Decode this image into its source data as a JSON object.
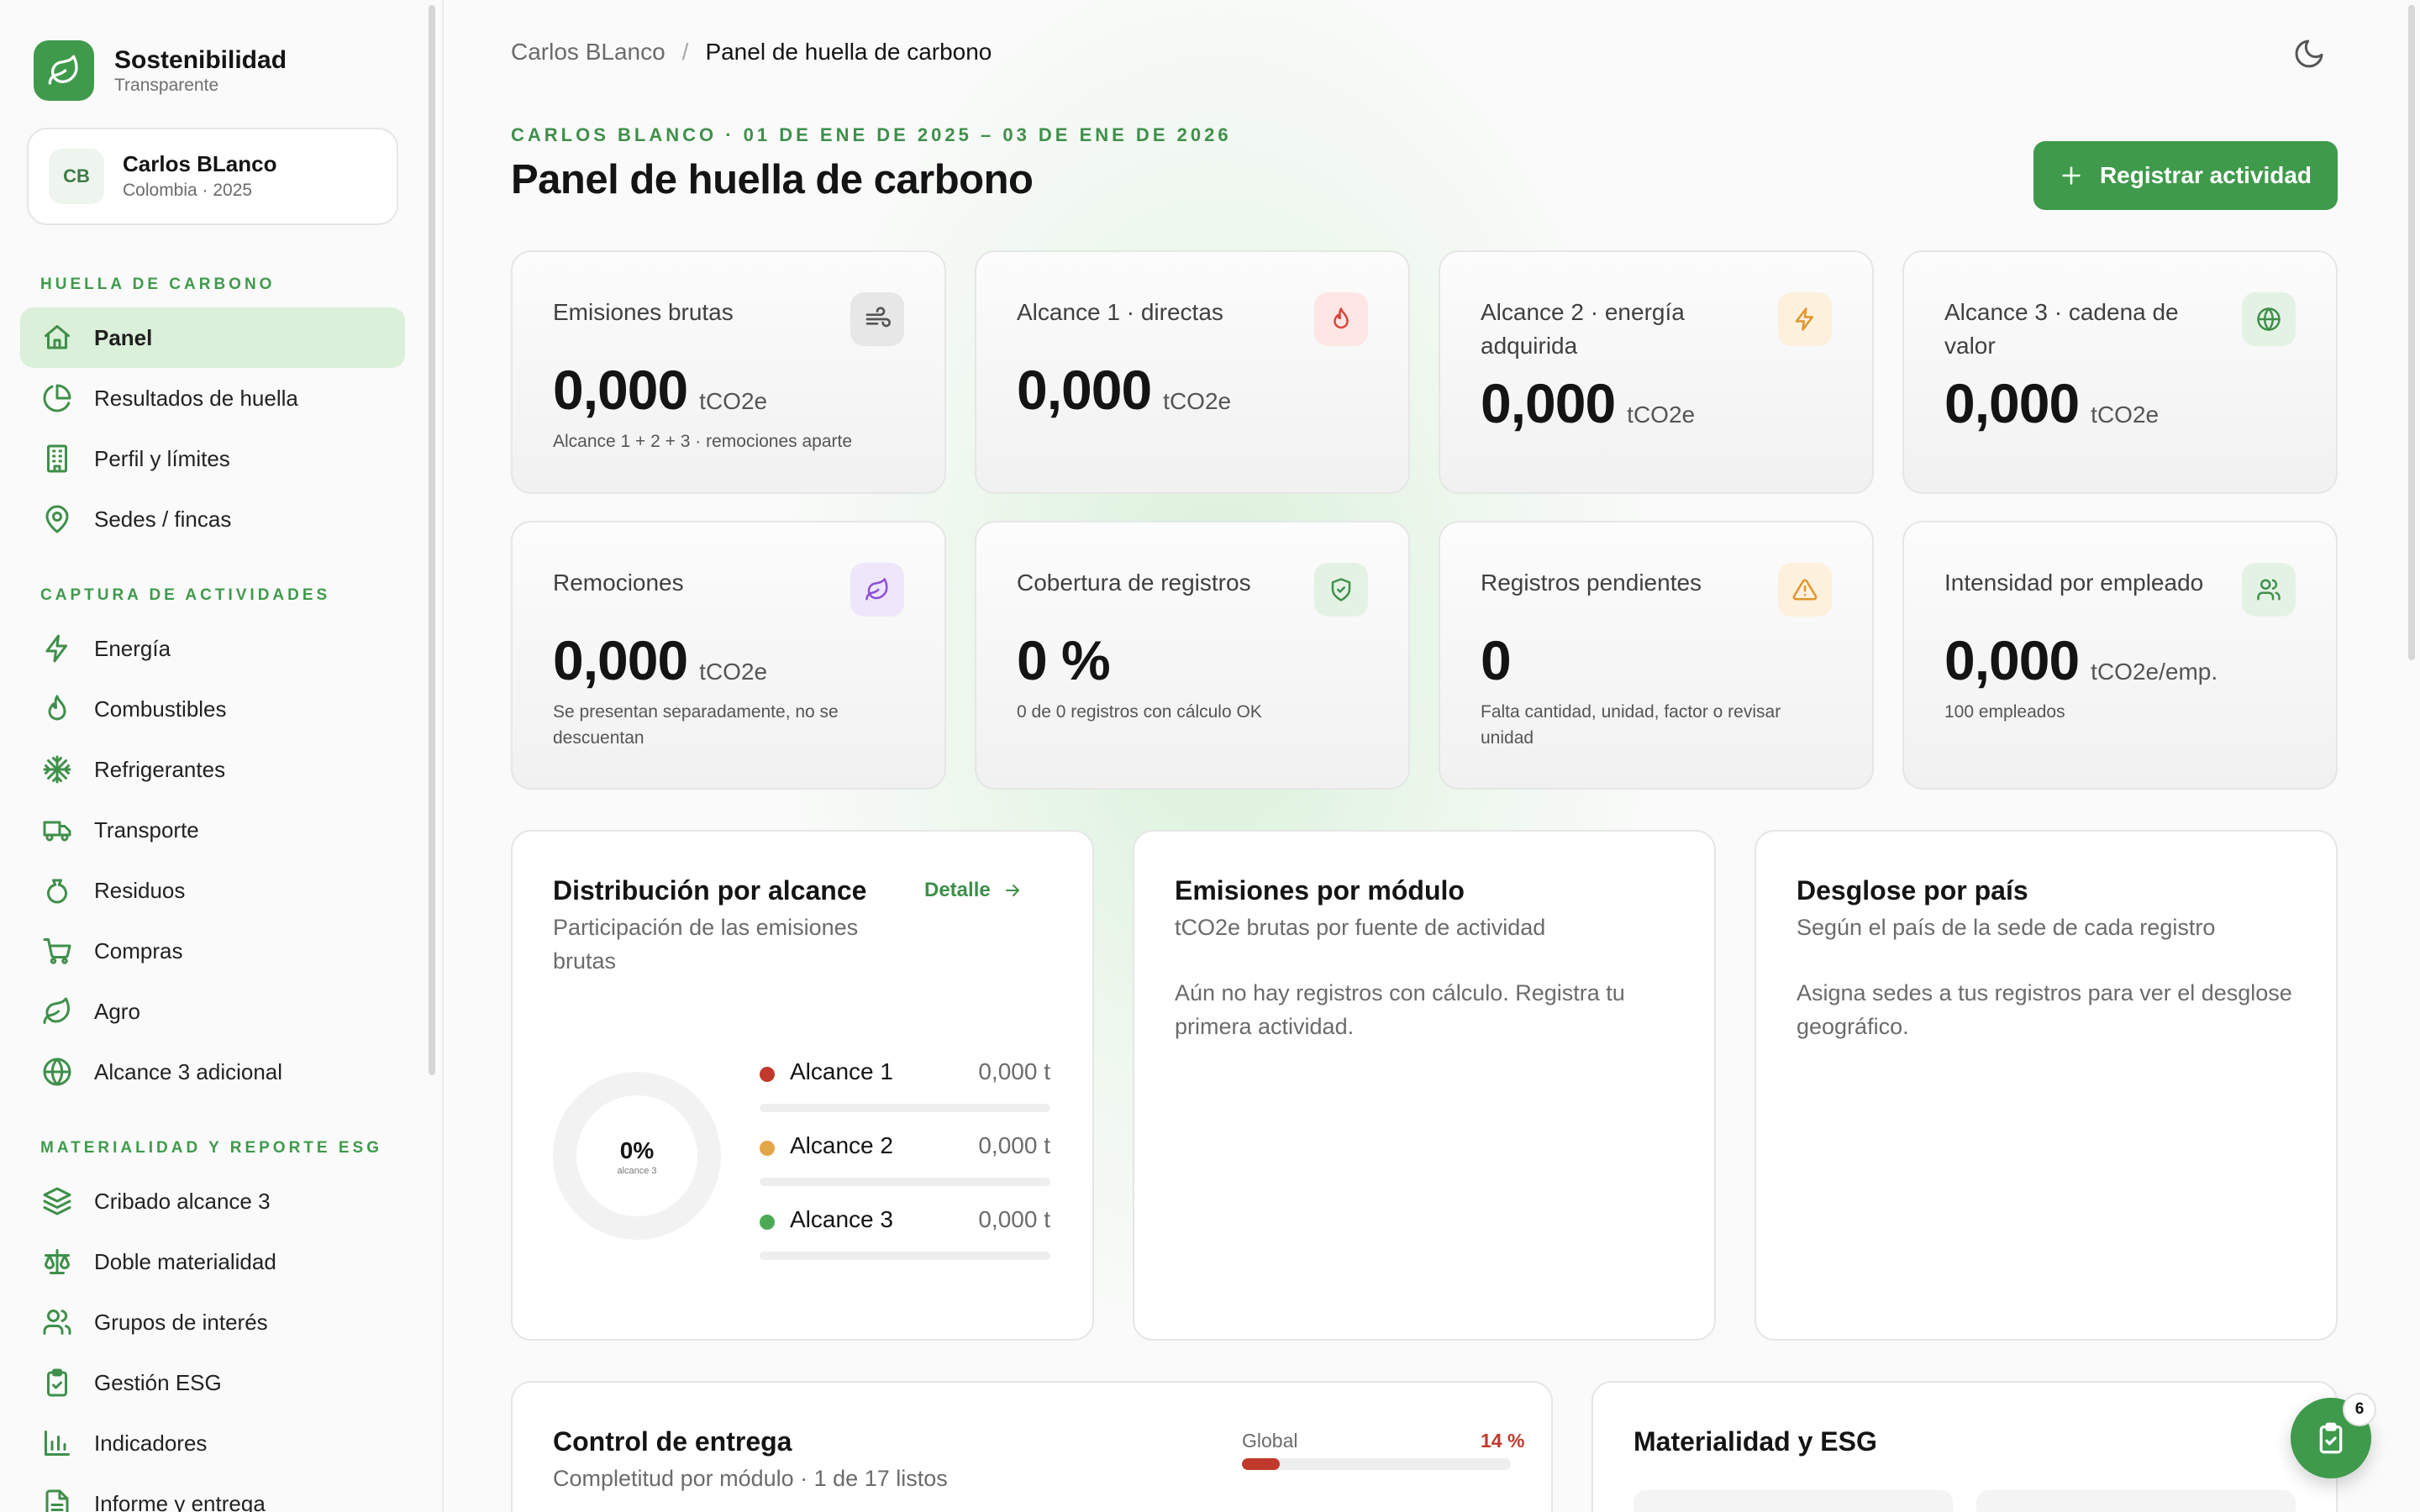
{
  "brand": {
    "name": "Sostenibilidad",
    "subtitle": "Transparente"
  },
  "user": {
    "initials": "CB",
    "name": "Carlos BLanco",
    "meta": "Colombia · 2025"
  },
  "sidebar": {
    "sections": [
      {
        "title": "HUELLA DE CARBONO",
        "items": [
          {
            "label": "Panel",
            "icon": "home-icon",
            "active": true
          },
          {
            "label": "Resultados de huella",
            "icon": "pie-chart-icon"
          },
          {
            "label": "Perfil y límites",
            "icon": "building-icon"
          },
          {
            "label": "Sedes / fincas",
            "icon": "map-pin-icon"
          }
        ]
      },
      {
        "title": "CAPTURA DE ACTIVIDADES",
        "items": [
          {
            "label": "Energía",
            "icon": "lightning-icon"
          },
          {
            "label": "Combustibles",
            "icon": "flame-icon"
          },
          {
            "label": "Refrigerantes",
            "icon": "snowflake-icon"
          },
          {
            "label": "Transporte",
            "icon": "truck-icon"
          },
          {
            "label": "Residuos",
            "icon": "waste-bag-icon"
          },
          {
            "label": "Compras",
            "icon": "shopping-cart-icon"
          },
          {
            "label": "Agro",
            "icon": "leaf-icon"
          },
          {
            "label": "Alcance 3 adicional",
            "icon": "globe-icon"
          }
        ]
      },
      {
        "title": "MATERIALIDAD Y REPORTE ESG",
        "items": [
          {
            "label": "Cribado alcance 3",
            "icon": "layers-icon"
          },
          {
            "label": "Doble materialidad",
            "icon": "scale-icon"
          },
          {
            "label": "Grupos de interés",
            "icon": "users-icon"
          },
          {
            "label": "Gestión ESG",
            "icon": "clipboard-check-icon"
          },
          {
            "label": "Indicadores",
            "icon": "bar-chart-icon"
          },
          {
            "label": "Informe y entrega",
            "icon": "document-icon"
          }
        ]
      }
    ]
  },
  "breadcrumb": {
    "parent": "Carlos BLanco",
    "separator": "/",
    "current": "Panel de huella de carbono"
  },
  "header": {
    "eyebrow": "CARLOS BLANCO · 01 DE ENE DE 2025 – 03 DE ENE DE 2026",
    "title": "Panel de huella de carbono",
    "primary_action": "Registrar actividad"
  },
  "kpis": [
    {
      "label": "Emisiones brutas",
      "value": "0,000",
      "unit": "tCO2e",
      "note": "Alcance 1 + 2 + 3 · remociones aparte",
      "icon": "wind-icon",
      "icon_color": "#555555",
      "icon_bg": "#e7e7e7"
    },
    {
      "label": "Alcance 1 · directas",
      "value": "0,000",
      "unit": "tCO2e",
      "note": "",
      "icon": "flame-icon",
      "icon_color": "#d9443a",
      "icon_bg": "#fde6e4"
    },
    {
      "label": "Alcance 2 · energía adquirida",
      "value": "0,000",
      "unit": "tCO2e",
      "note": "",
      "icon": "lightning-icon",
      "icon_color": "#e0952b",
      "icon_bg": "#fdf0dc"
    },
    {
      "label": "Alcance 3 · cadena de valor",
      "value": "0,000",
      "unit": "tCO2e",
      "note": "",
      "icon": "globe-icon",
      "icon_color": "#3f8f4a",
      "icon_bg": "#e4f2e4"
    },
    {
      "label": "Remociones",
      "value": "0,000",
      "unit": "tCO2e",
      "note": "Se presentan separadamente, no se descuentan",
      "icon": "leaf-icon",
      "icon_color": "#8b4fd6",
      "icon_bg": "#efe6fb"
    },
    {
      "label": "Cobertura de registros",
      "value": "0 %",
      "unit": "",
      "note": "0 de 0 registros con cálculo OK",
      "icon": "shield-check-icon",
      "icon_color": "#3f8f4a",
      "icon_bg": "#e4f2e4"
    },
    {
      "label": "Registros pendientes",
      "value": "0",
      "unit": "",
      "note": "Falta cantidad, unidad, factor o revisar unidad",
      "icon": "warning-icon",
      "icon_color": "#e0952b",
      "icon_bg": "#fdf0dc"
    },
    {
      "label": "Intensidad por empleado",
      "value": "0,000",
      "unit": "tCO2e/emp.",
      "note": "100 empleados",
      "icon": "users-icon",
      "icon_color": "#3f8f4a",
      "icon_bg": "#e4f2e4"
    }
  ],
  "distribution": {
    "title": "Distribución por alcance",
    "subtitle": "Participación de las emisiones brutas",
    "detail_link": "Detalle",
    "donut_value": "0%",
    "donut_label": "alcance 3",
    "donut_fraction": 0,
    "scopes": [
      {
        "name": "Alcance 1",
        "value": "0,000 t",
        "color": "#c0392b",
        "fraction": 0
      },
      {
        "name": "Alcance 2",
        "value": "0,000 t",
        "color": "#e3a54a",
        "fraction": 0
      },
      {
        "name": "Alcance 3",
        "value": "0,000 t",
        "color": "#4caa55",
        "fraction": 0
      }
    ]
  },
  "modules": {
    "title": "Emisiones por módulo",
    "subtitle": "tCO2e brutas por fuente de actividad",
    "empty": "Aún no hay registros con cálculo. Registra tu primera actividad."
  },
  "countries": {
    "title": "Desglose por país",
    "subtitle": "Según el país de la sede de cada registro",
    "empty": "Asigna sedes a tus registros para ver el desglose geográfico."
  },
  "delivery": {
    "title": "Control de entrega",
    "subtitle": "Completitud por módulo · 1 de 17 listos",
    "global_label": "Global",
    "global_pct": "14 %",
    "global_fraction": 0.14
  },
  "materiality": {
    "title": "Materialidad y ESG"
  },
  "fab": {
    "badge": "6"
  },
  "colors": {
    "accent": "#3f9a4c",
    "danger": "#c0392b"
  }
}
